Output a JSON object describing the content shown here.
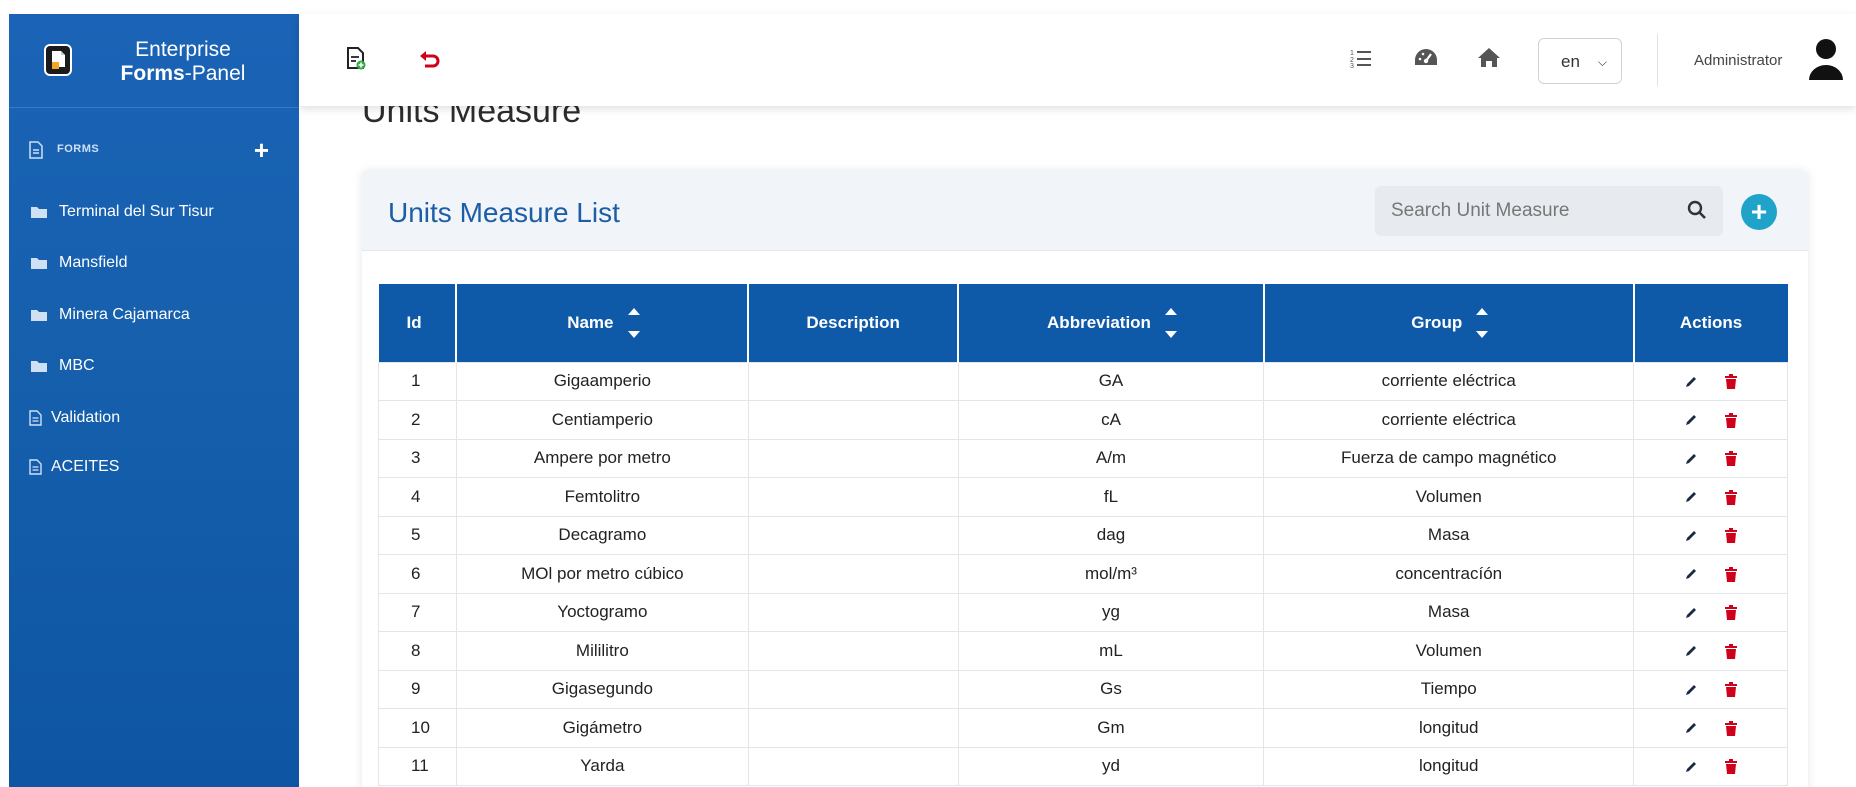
{
  "brand": {
    "line1": "Enterprise",
    "line2_bold": "Forms",
    "line2_rest": "-Panel"
  },
  "sidebar": {
    "section_label": "FORMS",
    "add_label": "+",
    "folders": [
      {
        "label": "Terminal del Sur Tisur"
      },
      {
        "label": "Mansfield"
      },
      {
        "label": "Minera Cajamarca"
      },
      {
        "label": "MBC"
      }
    ],
    "documents": [
      {
        "label": "Validation"
      },
      {
        "label": "ACEITES"
      }
    ]
  },
  "topbar": {
    "language": "en",
    "user": "Administrator",
    "icons": [
      "new-form-icon",
      "undo-icon",
      "list-icon",
      "dashboard-icon",
      "home-icon",
      "user-avatar-icon"
    ]
  },
  "page": {
    "title": "Units Measure"
  },
  "card": {
    "title": "Units Measure List",
    "search_placeholder": "Search Unit Measure",
    "add_button": "+"
  },
  "table": {
    "headers": {
      "id": "Id",
      "name": "Name",
      "description": "Description",
      "abbreviation": "Abbreviation",
      "group": "Group",
      "actions": "Actions"
    },
    "rows": [
      {
        "id": "1",
        "name": "Gigaamperio",
        "description": "",
        "abbreviation": "GA",
        "group": "corriente eléctrica"
      },
      {
        "id": "2",
        "name": "Centiamperio",
        "description": "",
        "abbreviation": "cA",
        "group": "corriente eléctrica"
      },
      {
        "id": "3",
        "name": "Ampere por metro",
        "description": "",
        "abbreviation": "A/m",
        "group": "Fuerza de campo magnético"
      },
      {
        "id": "4",
        "name": "Femtolitro",
        "description": "",
        "abbreviation": "fL",
        "group": "Volumen"
      },
      {
        "id": "5",
        "name": "Decagramo",
        "description": "",
        "abbreviation": "dag",
        "group": "Masa"
      },
      {
        "id": "6",
        "name": "MOl por metro cúbico",
        "description": "",
        "abbreviation": "mol/m³",
        "group": "concentracíón"
      },
      {
        "id": "7",
        "name": "Yoctogramo",
        "description": "",
        "abbreviation": "yg",
        "group": "Masa"
      },
      {
        "id": "8",
        "name": "Mililitro",
        "description": "",
        "abbreviation": "mL",
        "group": "Volumen"
      },
      {
        "id": "9",
        "name": "Gigasegundo",
        "description": "",
        "abbreviation": "Gs",
        "group": "Tiempo"
      },
      {
        "id": "10",
        "name": "Gigámetro",
        "description": "",
        "abbreviation": "Gm",
        "group": "longitud"
      },
      {
        "id": "11",
        "name": "Yarda",
        "description": "",
        "abbreviation": "yd",
        "group": "longitud"
      }
    ]
  },
  "colors": {
    "sidebar": "#1660ae",
    "header": "#0f5aa8",
    "accent": "#1fa3c9",
    "delete": "#d0021b",
    "title": "#1c5ea6"
  }
}
